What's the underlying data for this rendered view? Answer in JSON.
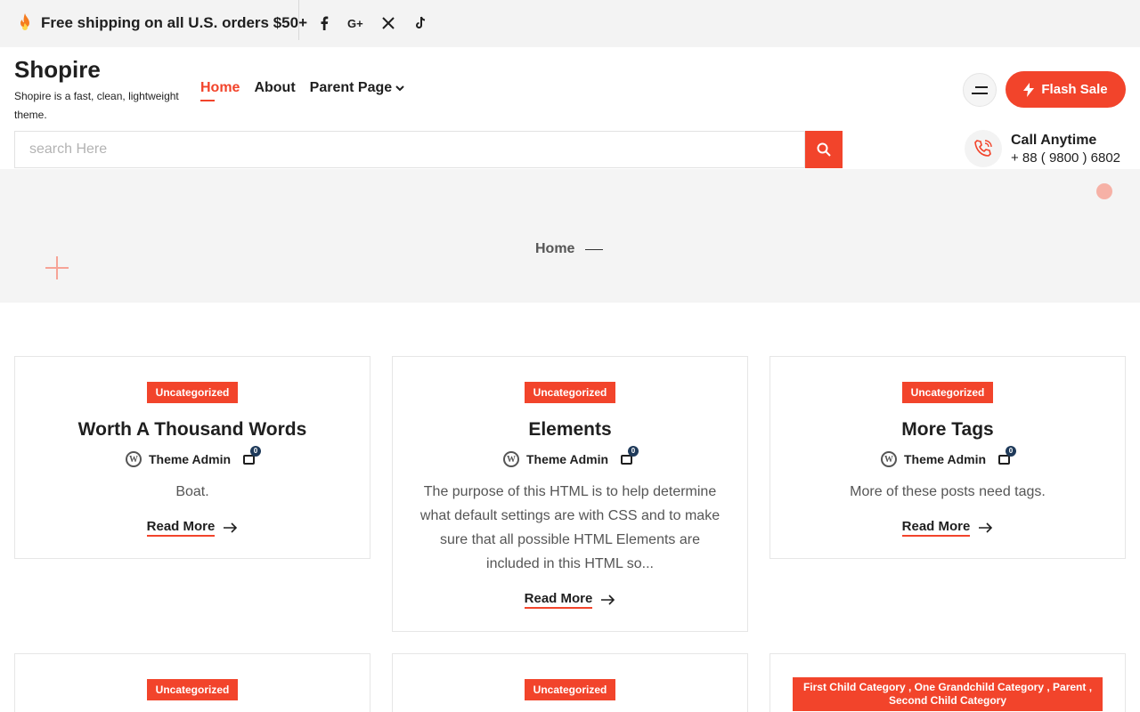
{
  "topbar": {
    "promo_text": "Free shipping on all U.S. orders $50+",
    "social": [
      "facebook-icon",
      "google-plus-icon",
      "x-twitter-icon",
      "tiktok-icon"
    ]
  },
  "site": {
    "title": "Shopire",
    "tagline": "Shopire is a fast, clean, lightweight theme."
  },
  "nav": {
    "items": [
      {
        "label": "Home",
        "active": true
      },
      {
        "label": "About",
        "active": false
      },
      {
        "label": "Parent Page",
        "active": false,
        "has_dropdown": true
      }
    ]
  },
  "header": {
    "flash_sale_label": "Flash Sale",
    "call_title": "Call Anytime",
    "call_number": "+ 88 ( 9800 ) 6802"
  },
  "search": {
    "placeholder": "search Here"
  },
  "breadcrumb": {
    "current": "Home"
  },
  "colors": {
    "accent": "#f2442b",
    "hero_bg": "#f4f4f4",
    "topbar_bg": "#f3f3f3"
  },
  "posts": [
    {
      "category": "Uncategorized",
      "title": "Worth A Thousand Words",
      "author": "Theme Admin",
      "comments": "0",
      "excerpt": "Boat.",
      "read_more": "Read More"
    },
    {
      "category": "Uncategorized",
      "title": "Elements",
      "author": "Theme Admin",
      "comments": "0",
      "excerpt": "The purpose of this HTML is to help determine what default settings are with CSS and to make sure that all possible HTML Elements are included in this HTML so...",
      "read_more": "Read More"
    },
    {
      "category": "Uncategorized",
      "title": "More Tags",
      "author": "Theme Admin",
      "comments": "0",
      "excerpt": "More of these posts need tags.",
      "read_more": "Read More"
    }
  ],
  "posts_row2": [
    {
      "category": "Uncategorized"
    },
    {
      "category": "Uncategorized"
    },
    {
      "category": "First Child Category , One Grandchild Category , Parent , Second Child Category"
    }
  ]
}
